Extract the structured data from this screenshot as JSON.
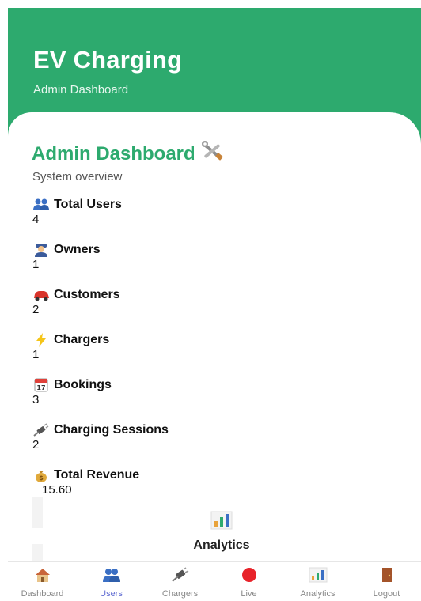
{
  "header": {
    "title": "EV Charging",
    "subtitle": "Admin Dashboard"
  },
  "page": {
    "title": "Admin Dashboard",
    "title_icon": "tools-icon",
    "subtitle": "System overview"
  },
  "stats": [
    {
      "label": "Total Users",
      "value": "4",
      "icon": "users-icon"
    },
    {
      "label": "Owners",
      "value": "1",
      "icon": "owner-icon"
    },
    {
      "label": "Customers",
      "value": "2",
      "icon": "car-icon"
    },
    {
      "label": "Chargers",
      "value": "1",
      "icon": "lightning-icon"
    },
    {
      "label": "Bookings",
      "value": "3",
      "icon": "calendar-icon"
    },
    {
      "label": "Charging Sessions",
      "value": "2",
      "icon": "plug-icon"
    },
    {
      "label": "Total Revenue",
      "value": "15.60",
      "icon": "money-bag-icon"
    }
  ],
  "analytics": {
    "label": "Analytics",
    "icon": "bar-chart-icon"
  },
  "nav": [
    {
      "label": "Dashboard",
      "icon": "home-icon"
    },
    {
      "label": "Users",
      "icon": "users-icon"
    },
    {
      "label": "Chargers",
      "icon": "plug-icon"
    },
    {
      "label": "Live",
      "icon": "red-circle-icon"
    },
    {
      "label": "Analytics",
      "icon": "bar-chart-icon"
    },
    {
      "label": "Logout",
      "icon": "door-icon"
    }
  ],
  "colors": {
    "primary": "#2daa6e",
    "nav_active": "#5e6ad2",
    "live": "#e8232a"
  }
}
